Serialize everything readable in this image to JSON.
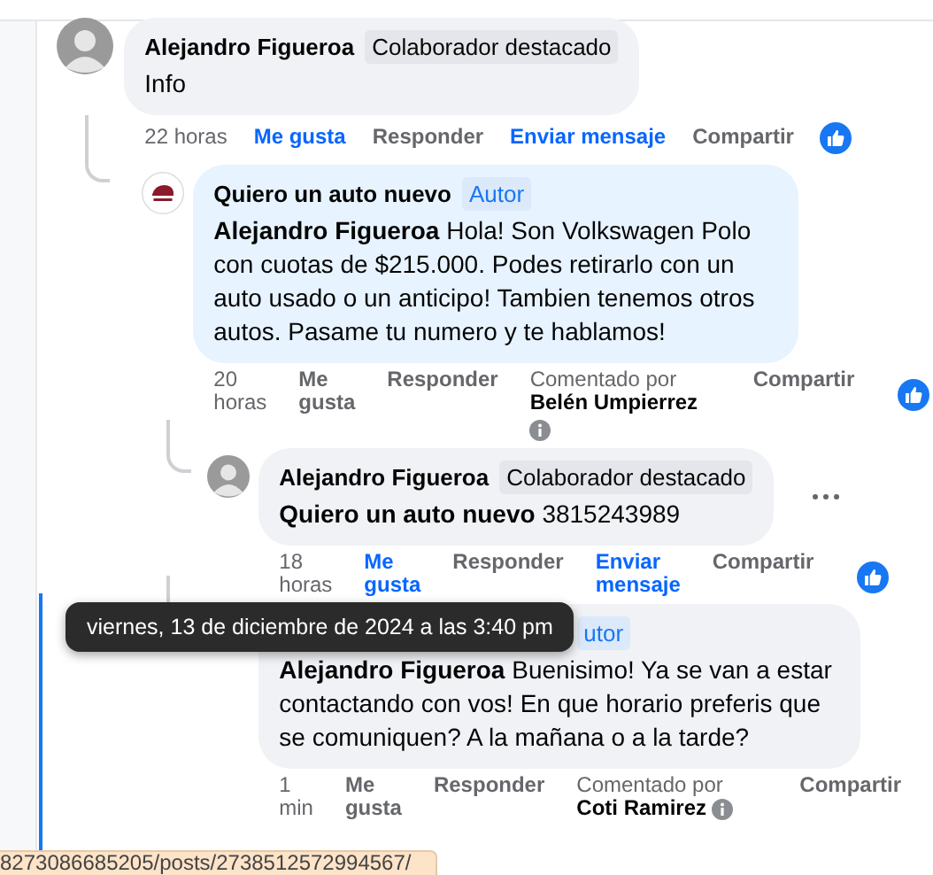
{
  "comments": [
    {
      "kind": "person",
      "author": "Alejandro Figueroa",
      "badge": {
        "kind": "collaborator",
        "text": "Colaborador destacado"
      },
      "body": "Info",
      "highlighted": false,
      "menu": false,
      "actions": [
        {
          "kind": "time",
          "text": "22 horas"
        },
        {
          "kind": "like",
          "text": "Me gusta",
          "selected": true
        },
        {
          "kind": "plain",
          "text": "Responder"
        },
        {
          "kind": "link",
          "text": "Enviar mensaje"
        },
        {
          "kind": "plain",
          "text": "Compartir"
        }
      ],
      "children": [
        {
          "kind": "page",
          "author": "Quiero un auto nuevo",
          "badge": {
            "kind": "author",
            "text": "Autor"
          },
          "body": "**Alejandro Figueroa** Hola! Son Volkswagen Polo con cuotas de $215.000. Podes retirarlo con un auto usado o un anticipo! Tambien tenemos otros autos. Pasame tu numero y te hablamos!",
          "highlighted": false,
          "menu": false,
          "actions": [
            {
              "kind": "time",
              "text": "20 horas"
            },
            {
              "kind": "like",
              "text": "Me gusta",
              "selected": false
            },
            {
              "kind": "plain",
              "text": "Responder"
            },
            {
              "kind": "byline",
              "label": "Comentado por",
              "text": "Belén Umpierrez"
            },
            {
              "kind": "plain",
              "text": "Compartir"
            }
          ],
          "children": [
            {
              "kind": "person",
              "author": "Alejandro Figueroa",
              "badge": {
                "kind": "collaborator",
                "text": "Colaborador destacado"
              },
              "body": "**Quiero un auto nuevo** 3815243989",
              "highlighted": false,
              "menu": true,
              "actions": [
                {
                  "kind": "time",
                  "text": "18 horas"
                },
                {
                  "kind": "like",
                  "text": "Me gusta",
                  "selected": true
                },
                {
                  "kind": "plain",
                  "text": "Responder"
                },
                {
                  "kind": "link",
                  "text": "Enviar mensaje"
                },
                {
                  "kind": "plain",
                  "text": "Compartir"
                }
              ]
            },
            {
              "kind": "covered",
              "badge": {
                "kind": "author",
                "text": "utor"
              },
              "body": "**Alejandro Figueroa** Buenisimo! Ya se van a estar contactando con vos! En que horario preferis que se comuniquen? A la mañana o a la tarde?",
              "highlighted": true,
              "menu": false,
              "actions": [
                {
                  "kind": "time",
                  "text": "1 min"
                },
                {
                  "kind": "like",
                  "text": "Me gusta",
                  "selected": false
                },
                {
                  "kind": "plain",
                  "text": "Responder"
                },
                {
                  "kind": "byline",
                  "label": "Comentado por",
                  "text": "Coti Ramirez"
                },
                {
                  "kind": "plain",
                  "text": "Compartir"
                }
              ]
            }
          ]
        }
      ]
    }
  ],
  "tooltip": "viernes, 13 de diciembre de 2024 a las 3:40 pm",
  "status_bar": "8273086685205/posts/2738512572994567/"
}
